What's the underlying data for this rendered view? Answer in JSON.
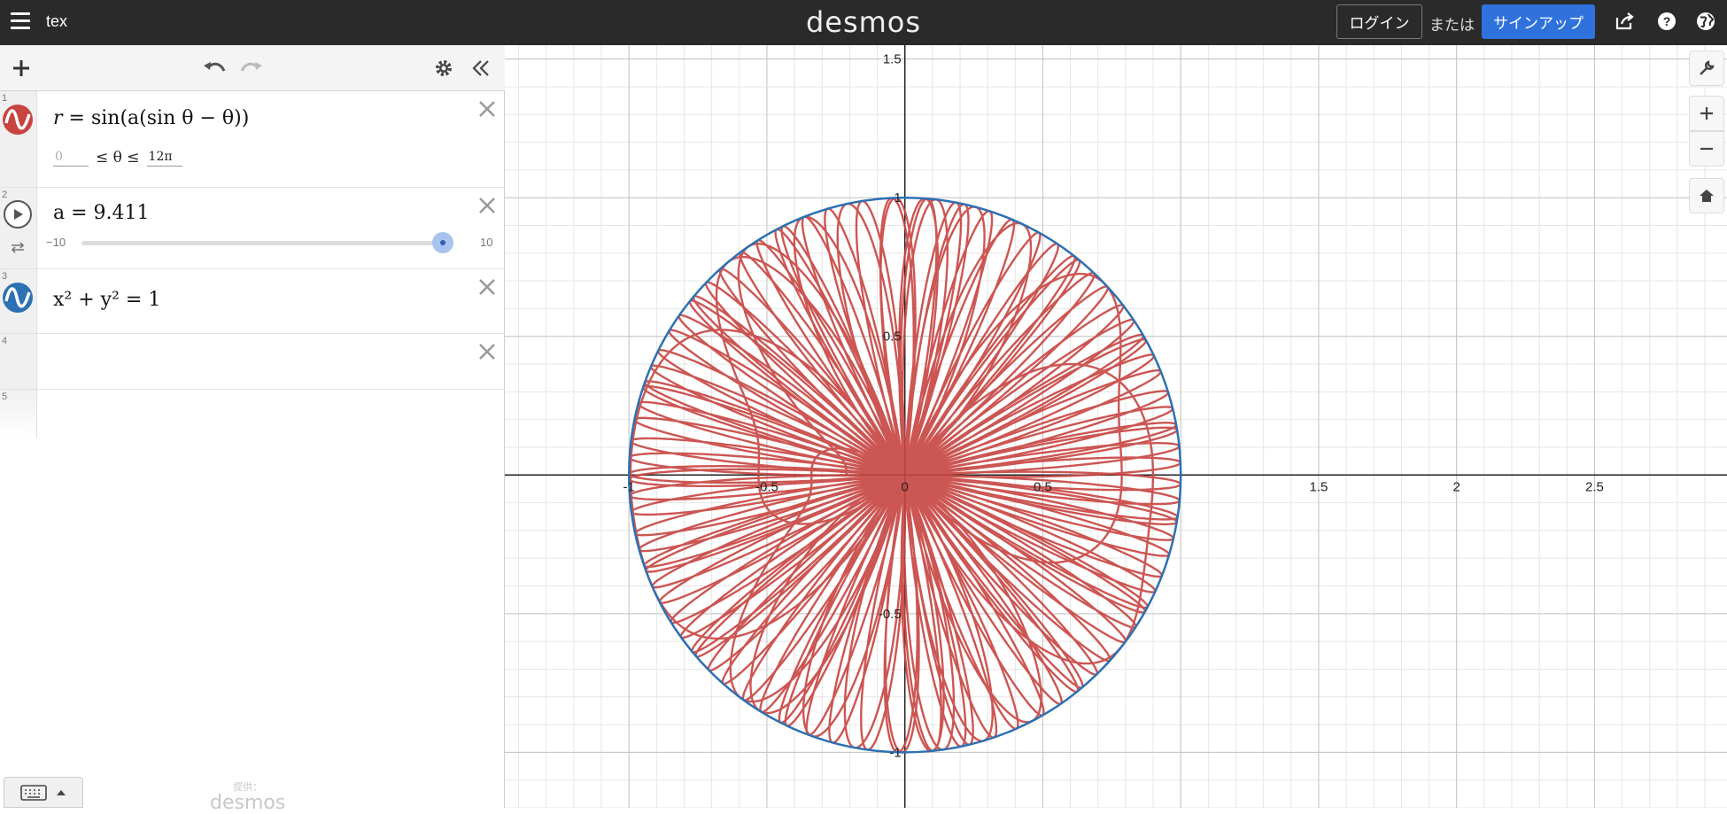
{
  "header": {
    "graph_title": "tex",
    "logo": "desmos",
    "login_label": "ログイン",
    "or_text": "または",
    "signup_label": "サインアップ"
  },
  "expressions": [
    {
      "index": "1",
      "latex_parts": {
        "lhs": "r",
        "eq": "=",
        "rhs": "sin(a(sin θ − θ))"
      },
      "domain": {
        "min_placeholder": "0",
        "symbol": "≤ θ ≤",
        "max": "12π"
      },
      "color": "#c74440"
    },
    {
      "index": "2",
      "variable": "a",
      "value_text": "a = 9.411",
      "slider": {
        "min": "−10",
        "max": "10",
        "value": 9.411,
        "range_min": -10,
        "range_max": 10
      }
    },
    {
      "index": "3",
      "text": "x² + y² = 1",
      "color": "#2d70b3"
    },
    {
      "index": "4"
    },
    {
      "index": "5"
    }
  ],
  "footer": {
    "powered_by": "提供：",
    "brand": "desmos"
  },
  "graph": {
    "x_tick_labels": [
      "-1",
      "-0.5",
      "0",
      "0.5",
      "1.5",
      "2",
      "2.5"
    ],
    "y_tick_labels": [
      "1.5",
      "1",
      "0.5",
      "-0.5",
      "-1"
    ],
    "x_ticks": [
      -1,
      -0.5,
      0,
      0.5,
      1.5,
      2,
      2.5
    ],
    "y_ticks": [
      1.5,
      1,
      0.5,
      -0.5,
      -1
    ],
    "x_range": [
      -1.45,
      2.98
    ],
    "y_range": [
      -1.2,
      1.55
    ],
    "curve_color": "#c74440",
    "circle_color": "#2d70b3",
    "parameter_a": 9.411,
    "theta_max_multiple_of_pi": 12
  }
}
